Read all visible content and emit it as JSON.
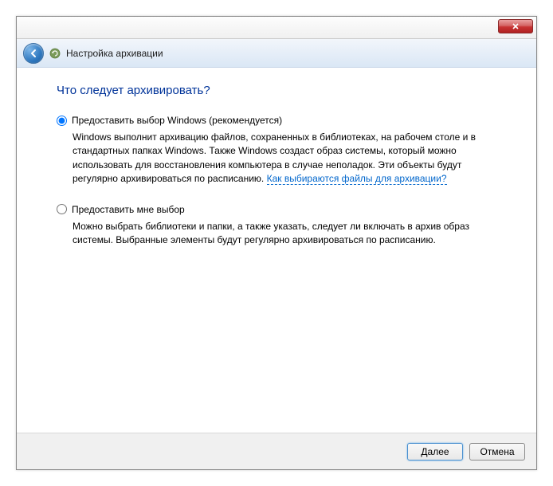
{
  "header": {
    "title": "Настройка архивации"
  },
  "content": {
    "question": "Что следует архивировать?"
  },
  "options": [
    {
      "label": "Предоставить выбор Windows (рекомендуется)",
      "desc": "Windows выполнит архивацию файлов, сохраненных в библиотеках, на рабочем столе и в стандартных папках Windows. Также Windows создаст образ системы, который можно использовать для восстановления компьютера в случае неполадок. Эти объекты будут регулярно архивироваться по расписанию.",
      "link": "Как выбираются файлы для архивации?"
    },
    {
      "label": "Предоставить мне выбор",
      "desc": "Можно выбрать библиотеки и папки, а также указать, следует ли включать в архив образ системы. Выбранные элементы будут регулярно архивироваться по расписанию."
    }
  ],
  "footer": {
    "next": "Далее",
    "cancel": "Отмена"
  }
}
